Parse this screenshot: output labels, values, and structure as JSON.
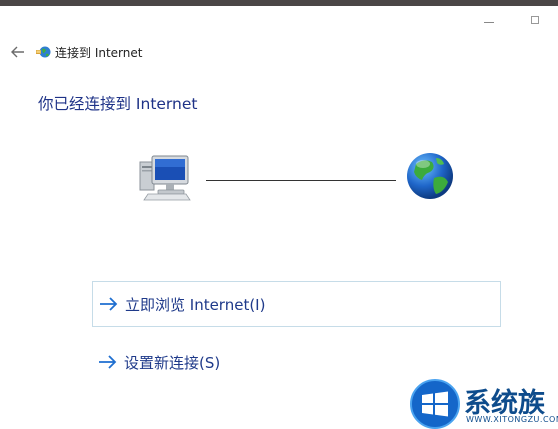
{
  "window": {
    "title": "连接到 Internet",
    "controls": {
      "minimize": "minimize",
      "maximize": "maximize"
    }
  },
  "main": {
    "heading": "你已经连接到 Internet",
    "diagram": {
      "left_icon": "computer-icon",
      "right_icon": "globe-icon"
    },
    "links": [
      {
        "label": "立即浏览 Internet(I)",
        "icon": "arrow-right-icon"
      },
      {
        "label": "设置新连接(S)",
        "icon": "arrow-right-icon"
      }
    ]
  },
  "watermark": {
    "brand": "系统族",
    "domain": "WWW.XITONGZU.COM"
  },
  "colors": {
    "heading": "#1e3287",
    "link": "#1f3a8a",
    "link_border": "#c6dce8",
    "topbar": "#4b4646"
  }
}
